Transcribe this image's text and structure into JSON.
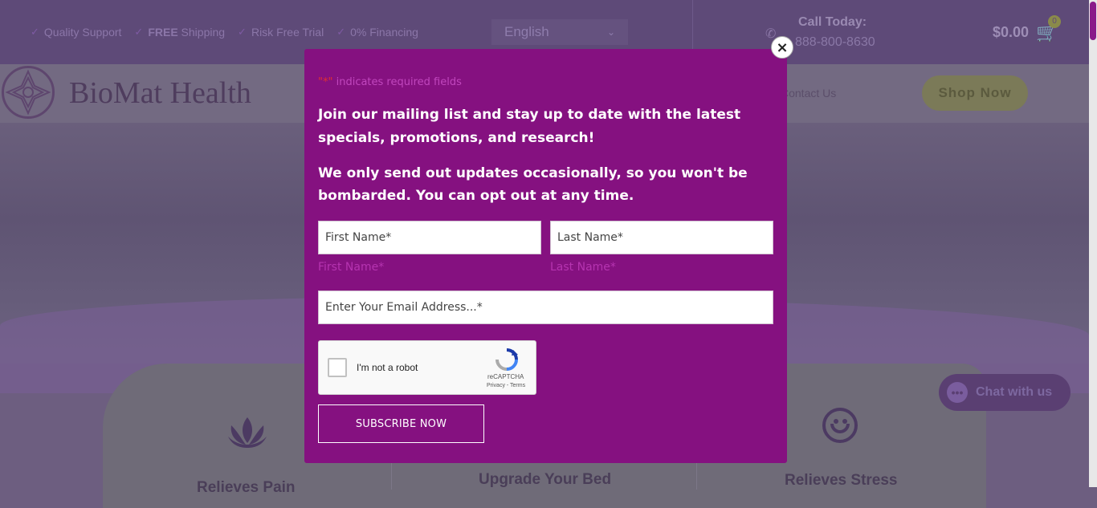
{
  "topbar": {
    "perks": [
      {
        "label": "Quality Support"
      },
      {
        "bold": "FREE",
        "label": " Shipping"
      },
      {
        "label": "Risk Free Trial"
      },
      {
        "label": "0% Financing"
      }
    ],
    "language": "English",
    "call_label": "Call Today:",
    "phone": "888-800-8630",
    "cart_total": "$0.00",
    "cart_count": "0"
  },
  "navbar": {
    "logo_text": "BioMat Health",
    "contact": "Contact Us",
    "shop_now": "Shop Now"
  },
  "features": [
    {
      "label": "Relieves Pain"
    },
    {
      "label": "Upgrade Your Bed"
    },
    {
      "label": "Relieves Stress"
    }
  ],
  "chat": {
    "label": "Chat with us"
  },
  "modal": {
    "required_note_asterisk": "\"*\"",
    "required_note": " indicates required fields",
    "paragraph1": "Join our mailing list and stay up to date with the latest specials, promotions, and research!",
    "paragraph2": "We only send out updates occasionally, so you won't be bombarded. You can opt out at any time.",
    "first_name_placeholder": "First Name*",
    "last_name_placeholder": "Last Name*",
    "first_name_sublabel": "First Name*",
    "last_name_sublabel": "Last Name*",
    "email_placeholder": "Enter Your Email Address...*",
    "captcha_label": "I'm not a robot",
    "captcha_brand": "reCAPTCHA",
    "captcha_links": "Privacy - Terms",
    "subscribe": "SUBSCRIBE NOW",
    "close_glyph": "×"
  },
  "colors": {
    "modal_bg": "#851180",
    "overlay": "#6d5e80",
    "accent": "#b534b0"
  }
}
